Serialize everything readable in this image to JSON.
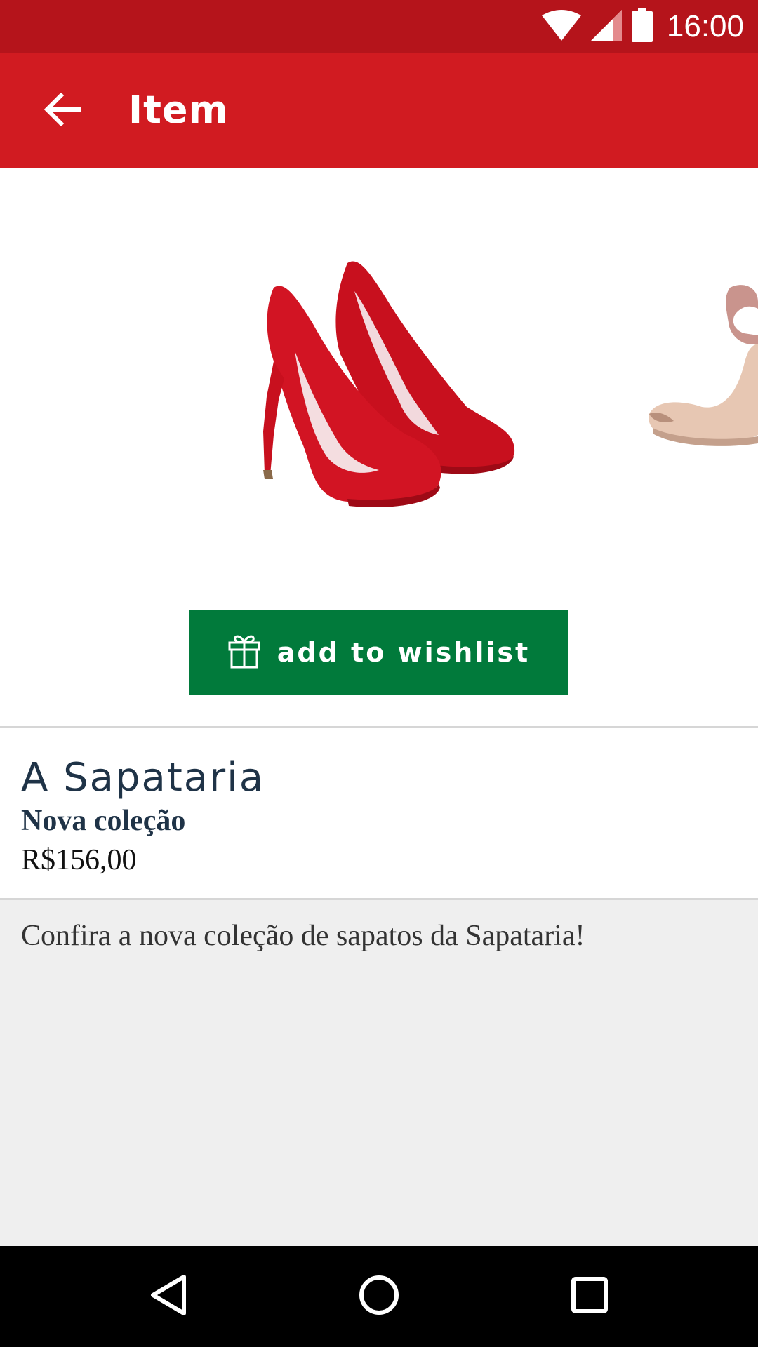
{
  "status_bar": {
    "time": "16:00",
    "icons": [
      "wifi-icon",
      "signal-icon",
      "battery-icon"
    ]
  },
  "app_bar": {
    "title": "Item",
    "back_icon": "arrow-back-icon"
  },
  "carousel": {
    "images": [
      "red-suede-pumps",
      "nude-ankle-strap-sandal"
    ]
  },
  "wishlist_button": {
    "label": "add to wishlist",
    "icon": "gift-icon"
  },
  "product": {
    "store_name": "A Sapataria",
    "collection": "Nova coleção",
    "price": "R$156,00"
  },
  "description": "Confira a nova coleção de sapatos da Sapataria!",
  "nav_bar": {
    "buttons": [
      "back-triangle-icon",
      "home-circle-icon",
      "recents-square-icon"
    ]
  },
  "colors": {
    "status_bar": "#b5141b",
    "app_bar": "#d11b21",
    "wishlist_button": "#017a3b",
    "text_dark": "#1f3347"
  }
}
